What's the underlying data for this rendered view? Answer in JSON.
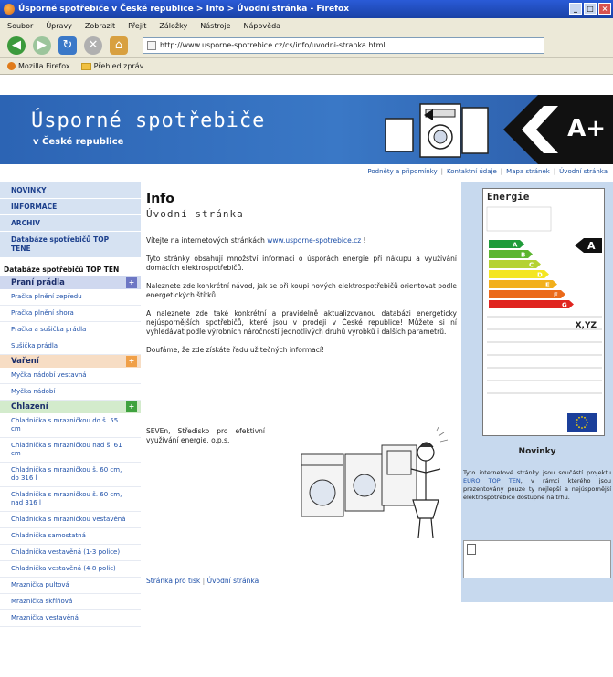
{
  "browser": {
    "title": "Úsporné spotřebiče v České republice > Info > Úvodní stránka - Firefox",
    "menu": [
      "Soubor",
      "Úpravy",
      "Zobrazit",
      "Přejít",
      "Záložky",
      "Nástroje",
      "Nápověda"
    ],
    "url": "http://www.usporne-spotrebice.cz/cs/info/uvodni-stranka.html",
    "bookmarks": [
      "Mozilla Firefox",
      "Přehled zpráv"
    ]
  },
  "header": {
    "title": "Úsporné spotřebiče",
    "subtitle": "v České republice",
    "badge": "A+"
  },
  "top_links": [
    "Podněty a připomínky",
    "Kontaktní údaje",
    "Mapa stránek",
    "Úvodní stránka"
  ],
  "sidebar": {
    "main": [
      "NOVINKY",
      "INFORMACE",
      "ARCHIV",
      "Databáze spotřebičů TOP TENE"
    ],
    "db_heading": "Databáze spotřebičů TOP TEN",
    "cat_praci": "Praní prádla",
    "praci_items": [
      "Pračka plnění zepředu",
      "Pračka plnění shora",
      "Pračka a sušička prádla",
      "Sušička prádla"
    ],
    "cat_vareni": "Vaření",
    "vareni_items": [
      "Myčka nádobí vestavná",
      "Myčka nádobí"
    ],
    "cat_chlazeni": "Chlazení",
    "chlazeni_items": [
      "Chladnička s mrazničkou do š. 55 cm",
      "Chladnička s mrazničkou nad š. 61 cm",
      "Chladnička s mrazničkou š. 60 cm, do 316 l",
      "Chladnička s mrazničkou š. 60 cm, nad 316 l",
      "Chladnička s mrazničkou vestavěná",
      "Chladnička samostatná",
      "Chladnička vestavěná (1-3 police)",
      "Chladnička vestavěná (4-8 polic)",
      "Mraznička pultová",
      "Mraznička skříňová",
      "Mraznička vestavěná"
    ],
    "square_glyph": "+"
  },
  "main": {
    "heading": "Info",
    "subheading": "Úvodní stránka",
    "welcome": "Vítejte na internetových stránkách",
    "welcome_link": "www.usporne-spotrebice.cz",
    "welcome_end": " !",
    "p1": "Tyto stránky obsahují množství informací o úsporách energie při nákupu a využívání domácích elektrospotřebičů.",
    "p2": "Naleznete zde konkrétní návod, jak se při koupi nových elektrospotřebičů orientovat podle energetických štítků.",
    "p3": "A naleznete zde také konkrétní a pravidelně aktualizovanou databázi energeticky nejúspornějších spotřebičů, které jsou v prodeji v České republice! Můžete si ní vyhledávat podle výrobních náročností jednotlivých druhů výrobků i dalších parametrů.",
    "p4": "Doufáme, že zde získáte řadu užitečných informací!",
    "org": "SEVEn, Středisko pro efektivní využívání energie, o.p.s.",
    "breadcrumb": [
      "Stránka pro tisk",
      "Úvodní stránka"
    ]
  },
  "energy_label": {
    "title": "Energie",
    "classes": [
      "A",
      "B",
      "C",
      "D",
      "E",
      "F",
      "G"
    ],
    "colors": [
      "#1f9b3a",
      "#5cb531",
      "#b5d233",
      "#f4e622",
      "#f2b01c",
      "#eb6a1a",
      "#e0251f"
    ],
    "rating": "A",
    "model": "X,YZ"
  },
  "novinky": {
    "title": "Novinky",
    "text_start": "Tyto internetové stránky jsou součástí projektu ",
    "link": "EURO TOP TEN",
    "text_end": ", v rámci kterého jsou prezentovány pouze ty nejlepší a nejúspornější elektrospotřebiče dostupné na trhu."
  }
}
